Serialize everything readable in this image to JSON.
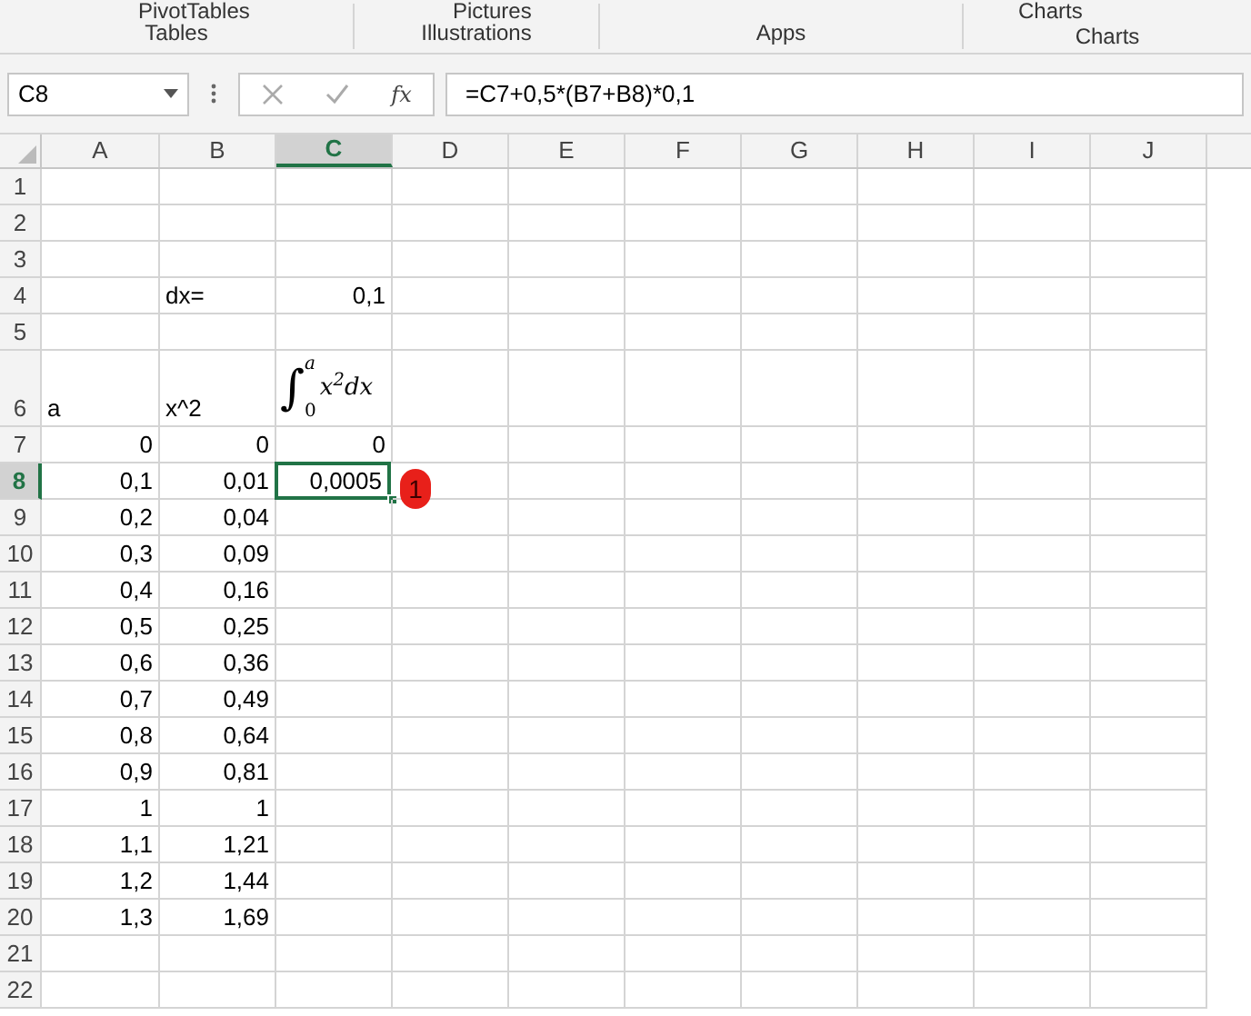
{
  "ribbon": {
    "top_labels": [
      {
        "text": "PivotTables"
      },
      {
        "text": "Pictures"
      },
      {
        "text": "Charts"
      }
    ],
    "groups": [
      "Tables",
      "Illustrations",
      "Apps",
      "Charts"
    ]
  },
  "formula_bar": {
    "name_box": "C8",
    "fx": "fx",
    "formula": "=C7+0,5*(B7+B8)*0,1"
  },
  "columns": [
    {
      "label": "A",
      "selected": false
    },
    {
      "label": "B",
      "selected": false
    },
    {
      "label": "C",
      "selected": true
    },
    {
      "label": "D",
      "selected": false
    },
    {
      "label": "E",
      "selected": false
    },
    {
      "label": "F",
      "selected": false
    },
    {
      "label": "G",
      "selected": false
    },
    {
      "label": "H",
      "selected": false
    },
    {
      "label": "I",
      "selected": false
    },
    {
      "label": "J",
      "selected": false
    }
  ],
  "rows": [
    {
      "number": "1",
      "selected": false,
      "cells": []
    },
    {
      "number": "2",
      "selected": false,
      "cells": []
    },
    {
      "number": "3",
      "selected": false,
      "cells": []
    },
    {
      "number": "4",
      "selected": false,
      "cells": [
        null,
        {
          "kind": "text",
          "text": "dx="
        },
        {
          "kind": "number",
          "text": "0,1"
        }
      ]
    },
    {
      "number": "5",
      "selected": false,
      "cells": []
    },
    {
      "number": "6",
      "selected": false,
      "tall": true,
      "cells": [
        {
          "kind": "text",
          "text": "a"
        },
        {
          "kind": "text",
          "text": "x^2"
        },
        {
          "kind": "integral",
          "sign": "∫",
          "lower": "0",
          "upper": "a",
          "body": "x$^{2}$dx"
        }
      ]
    },
    {
      "number": "7",
      "selected": false,
      "cells": [
        {
          "kind": "number",
          "text": "0"
        },
        {
          "kind": "number",
          "text": "0"
        },
        {
          "kind": "number",
          "text": "0"
        }
      ]
    },
    {
      "number": "8",
      "selected": true,
      "cells": [
        {
          "kind": "number",
          "text": "0,1"
        },
        {
          "kind": "number",
          "text": "0,01"
        },
        {
          "kind": "number",
          "text": "0,0005",
          "selected": true
        }
      ]
    },
    {
      "number": "9",
      "selected": false,
      "cells": [
        {
          "kind": "number",
          "text": "0,2"
        },
        {
          "kind": "number",
          "text": "0,04"
        }
      ]
    },
    {
      "number": "10",
      "selected": false,
      "cells": [
        {
          "kind": "number",
          "text": "0,3"
        },
        {
          "kind": "number",
          "text": "0,09"
        }
      ]
    },
    {
      "number": "11",
      "selected": false,
      "cells": [
        {
          "kind": "number",
          "text": "0,4"
        },
        {
          "kind": "number",
          "text": "0,16"
        }
      ]
    },
    {
      "number": "12",
      "selected": false,
      "cells": [
        {
          "kind": "number",
          "text": "0,5"
        },
        {
          "kind": "number",
          "text": "0,25"
        }
      ]
    },
    {
      "number": "13",
      "selected": false,
      "cells": [
        {
          "kind": "number",
          "text": "0,6"
        },
        {
          "kind": "number",
          "text": "0,36"
        }
      ]
    },
    {
      "number": "14",
      "selected": false,
      "cells": [
        {
          "kind": "number",
          "text": "0,7"
        },
        {
          "kind": "number",
          "text": "0,49"
        }
      ]
    },
    {
      "number": "15",
      "selected": false,
      "cells": [
        {
          "kind": "number",
          "text": "0,8"
        },
        {
          "kind": "number",
          "text": "0,64"
        }
      ]
    },
    {
      "number": "16",
      "selected": false,
      "cells": [
        {
          "kind": "number",
          "text": "0,9"
        },
        {
          "kind": "number",
          "text": "0,81"
        }
      ]
    },
    {
      "number": "17",
      "selected": false,
      "cells": [
        {
          "kind": "number",
          "text": "1"
        },
        {
          "kind": "number",
          "text": "1"
        }
      ]
    },
    {
      "number": "18",
      "selected": false,
      "cells": [
        {
          "kind": "number",
          "text": "1,1"
        },
        {
          "kind": "number",
          "text": "1,21"
        }
      ]
    },
    {
      "number": "19",
      "selected": false,
      "cells": [
        {
          "kind": "number",
          "text": "1,2"
        },
        {
          "kind": "number",
          "text": "1,44"
        }
      ]
    },
    {
      "number": "20",
      "selected": false,
      "cells": [
        {
          "kind": "number",
          "text": "1,3"
        },
        {
          "kind": "number",
          "text": "1,69"
        }
      ]
    },
    {
      "number": "21",
      "selected": false,
      "cells": []
    },
    {
      "number": "22",
      "selected": false,
      "cells": []
    }
  ],
  "step_marker": {
    "text": "1"
  }
}
